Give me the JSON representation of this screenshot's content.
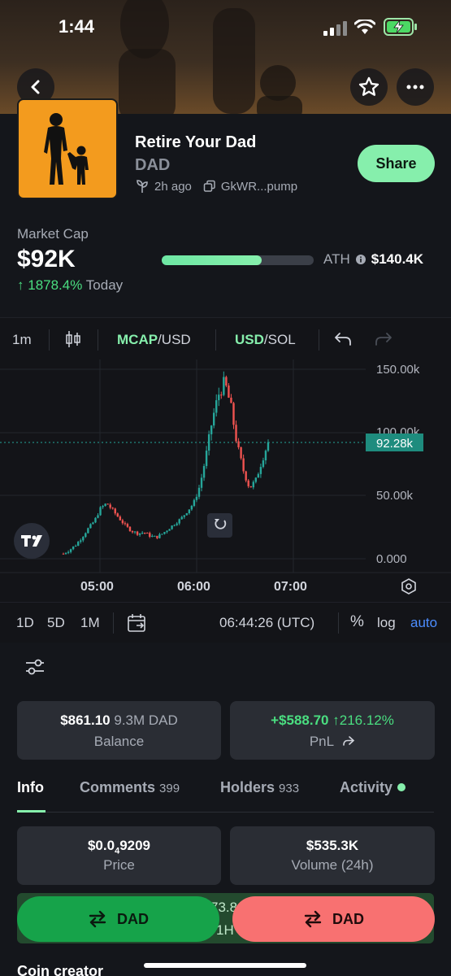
{
  "status_bar": {
    "time": "1:44"
  },
  "token": {
    "name": "Retire Your Dad",
    "ticker": "DAD",
    "age": "2h ago",
    "address": "GkWR...pump",
    "share_label": "Share"
  },
  "market": {
    "label": "Market Cap",
    "value": "$92K",
    "change": "1878.4%",
    "change_suffix": "Today",
    "progress_fraction": 0.66,
    "ath_label": "ATH",
    "ath_value": "$140.4K"
  },
  "toolbar": {
    "interval": "1m",
    "mcap_a": "MCAP",
    "mcap_b": "/USD",
    "cur_a": "USD",
    "cur_b": "/SOL"
  },
  "chart_data": {
    "type": "candlestick",
    "x_ticks": [
      "05:00",
      "06:00",
      "07:00"
    ],
    "y_ticks": [
      "150.00k",
      "100.00k",
      "50.00k",
      "0.000"
    ],
    "current_value_label": "92.28k",
    "ylim": [
      0,
      150000
    ],
    "approx_close_series": [
      4000,
      7000,
      11000,
      17000,
      24000,
      30000,
      40000,
      44000,
      38000,
      32000,
      26000,
      22000,
      20000,
      21000,
      18000,
      17000,
      20000,
      24000,
      28000,
      32000,
      38000,
      44000,
      58000,
      82000,
      110000,
      130000,
      140000,
      120000,
      90000,
      70000,
      56000,
      62000,
      78000,
      92280
    ],
    "colors": {
      "up": "#26a69a",
      "down": "#ef5350"
    }
  },
  "range_bar": {
    "r1": "1D",
    "r2": "5D",
    "r3": "1M",
    "clock": "06:44:26 (UTC)",
    "pct": "%",
    "log": "log",
    "auto": "auto"
  },
  "balance": {
    "amount": "$861.10",
    "tokens": "9.3M DAD",
    "label": "Balance"
  },
  "pnl": {
    "amount": "+$588.70",
    "pct": "216.12%",
    "label": "PnL"
  },
  "tabs": [
    {
      "label": "Info",
      "count": ""
    },
    {
      "label": "Comments",
      "count": "399"
    },
    {
      "label": "Holders",
      "count": "933"
    },
    {
      "label": "Activity",
      "count": ""
    }
  ],
  "price": {
    "main": "$0.0",
    "sub": "4",
    "rest": "9209",
    "label": "Price"
  },
  "volume": {
    "value": "$535.3K",
    "label": "Volume (24h)"
  },
  "strip": {
    "a": "73.8",
    "b": "1H"
  },
  "actions": {
    "buy_label": "DAD",
    "sell_label": "DAD"
  },
  "creator_label": "Coin creator",
  "colors": {
    "accent": "#86efac",
    "buy": "#16a34a",
    "sell": "#f87171",
    "bg": "#14161b"
  }
}
